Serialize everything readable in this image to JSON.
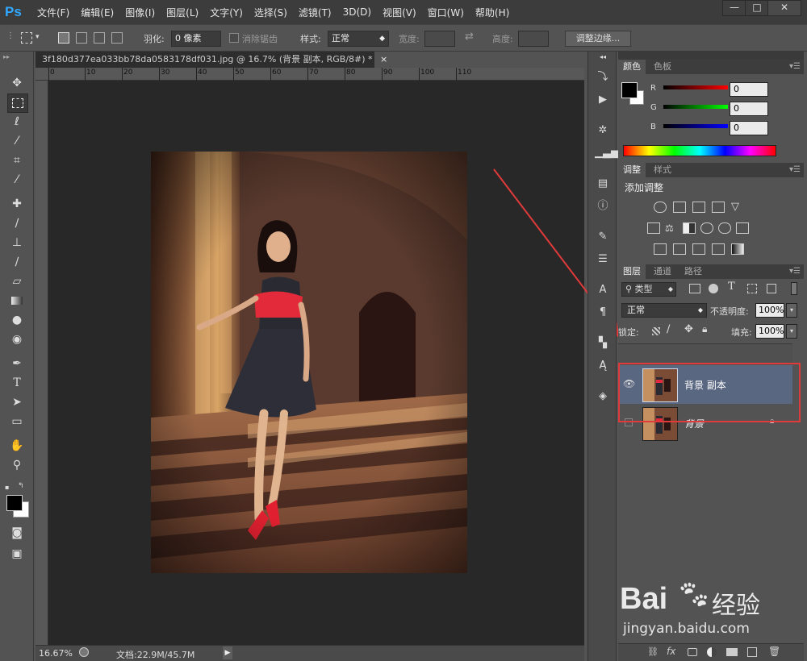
{
  "app": {
    "logo": "Ps",
    "menu": [
      "文件(F)",
      "编辑(E)",
      "图像(I)",
      "图层(L)",
      "文字(Y)",
      "选择(S)",
      "滤镜(T)",
      "3D(D)",
      "视图(V)",
      "窗口(W)",
      "帮助(H)"
    ],
    "window_controls": [
      "—",
      "□",
      "✕"
    ]
  },
  "options": {
    "feather_label": "羽化:",
    "feather_value": "0 像素",
    "antialias_label": "消除锯齿",
    "style_label": "样式:",
    "style_value": "正常",
    "width_label": "宽度:",
    "height_label": "高度:",
    "refine_edge": "调整边缘..."
  },
  "document": {
    "tab_title": "3f180d377ea033bb78da0583178df031.jpg @ 16.7% (背景 副本, RGB/8#) *",
    "tab_close": "×",
    "ruler_labels": [
      "0",
      "10",
      "20",
      "30",
      "40",
      "50",
      "60",
      "70",
      "80",
      "90",
      "100",
      "110"
    ],
    "zoom": "16.67%",
    "doc_size": "文档:22.9M/45.7M"
  },
  "color_panel": {
    "tabs": [
      "颜色",
      "色板"
    ],
    "channels": [
      {
        "label": "R",
        "value": "0"
      },
      {
        "label": "G",
        "value": "0"
      },
      {
        "label": "B",
        "value": "0"
      }
    ]
  },
  "adjust_panel": {
    "tabs": [
      "调整",
      "样式"
    ],
    "title": "添加调整"
  },
  "layers_panel": {
    "tabs": [
      "图层",
      "通道",
      "路径"
    ],
    "filter_kind": "类型",
    "blend_mode": "正常",
    "opacity_label": "不透明度:",
    "opacity_value": "100%",
    "lock_label": "锁定:",
    "fill_label": "填充:",
    "fill_value": "100%",
    "layers": [
      {
        "name": "背景 副本",
        "visible": true,
        "selected": true,
        "locked": false
      },
      {
        "name": "背景",
        "visible": false,
        "selected": false,
        "locked": true
      }
    ],
    "footer_icons": [
      "link-icon",
      "fx-icon",
      "mask-icon",
      "adjustment-icon",
      "folder-icon",
      "new-layer-icon",
      "trash-icon"
    ]
  },
  "watermark": {
    "brand_left": "Bai",
    "brand_right": "经验",
    "url": "jingyan.baidu.com"
  },
  "colors": {
    "highlight": "#e03a3a",
    "layer_selected": "#5a6780",
    "panel_bg": "#535353"
  }
}
